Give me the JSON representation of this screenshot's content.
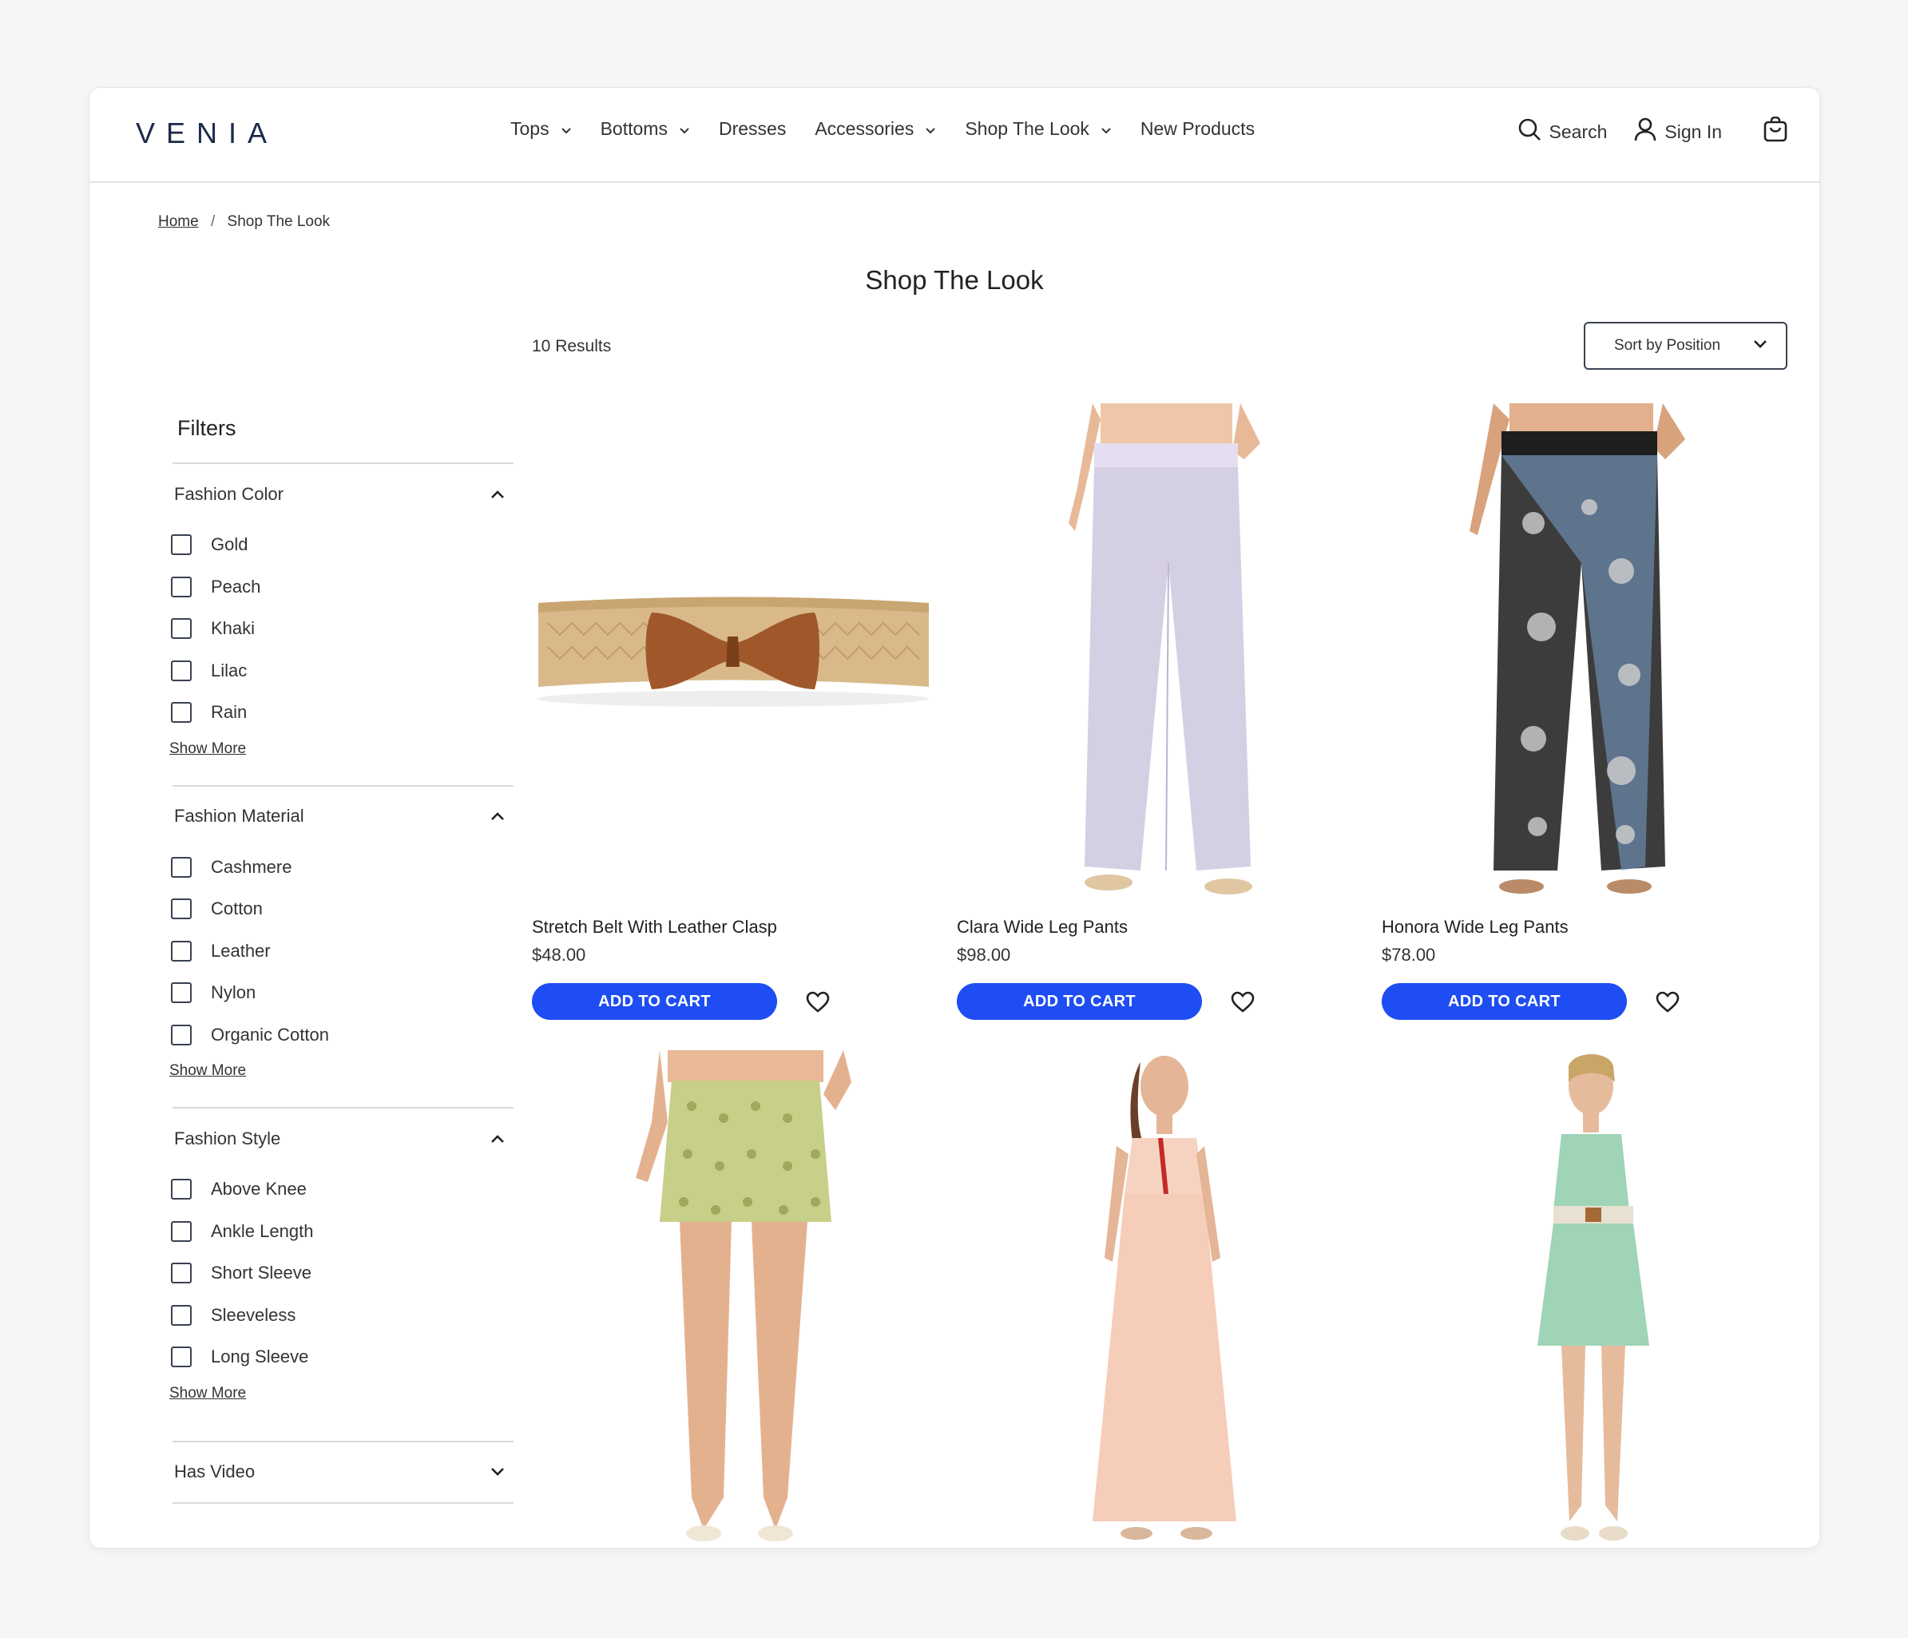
{
  "header": {
    "logo": "VENIA",
    "nav": [
      {
        "label": "Tops",
        "has_menu": true
      },
      {
        "label": "Bottoms",
        "has_menu": true
      },
      {
        "label": "Dresses",
        "has_menu": false
      },
      {
        "label": "Accessories",
        "has_menu": true
      },
      {
        "label": "Shop The Look",
        "has_menu": true
      },
      {
        "label": "New Products",
        "has_menu": false
      }
    ],
    "search_label": "Search",
    "signin_label": "Sign In"
  },
  "breadcrumb": {
    "home": "Home",
    "separator": "/",
    "current": "Shop The Look"
  },
  "page_title": "Shop The Look",
  "results_count": "10 Results",
  "sort_label": "Sort by Position",
  "filters": {
    "title": "Filters",
    "groups": [
      {
        "title": "Fashion Color",
        "options": [
          "Gold",
          "Peach",
          "Khaki",
          "Lilac",
          "Rain"
        ],
        "show_more": "Show More"
      },
      {
        "title": "Fashion Material",
        "options": [
          "Cashmere",
          "Cotton",
          "Leather",
          "Nylon",
          "Organic Cotton"
        ],
        "show_more": "Show More"
      },
      {
        "title": "Fashion Style",
        "options": [
          "Above Knee",
          "Ankle Length",
          "Short Sleeve",
          "Sleeveless",
          "Long Sleeve"
        ],
        "show_more": "Show More"
      }
    ],
    "collapsed_group": "Has Video"
  },
  "products": [
    {
      "name": "Stretch Belt With Leather Clasp",
      "price": "$48.00",
      "button": "ADD TO CART"
    },
    {
      "name": "Clara Wide Leg Pants",
      "price": "$98.00",
      "button": "ADD TO CART"
    },
    {
      "name": "Honora Wide Leg Pants",
      "price": "$78.00",
      "button": "ADD TO CART"
    }
  ],
  "colors": {
    "accent": "#1e4df3",
    "logo": "#1a2f8f",
    "text": "#222222"
  }
}
